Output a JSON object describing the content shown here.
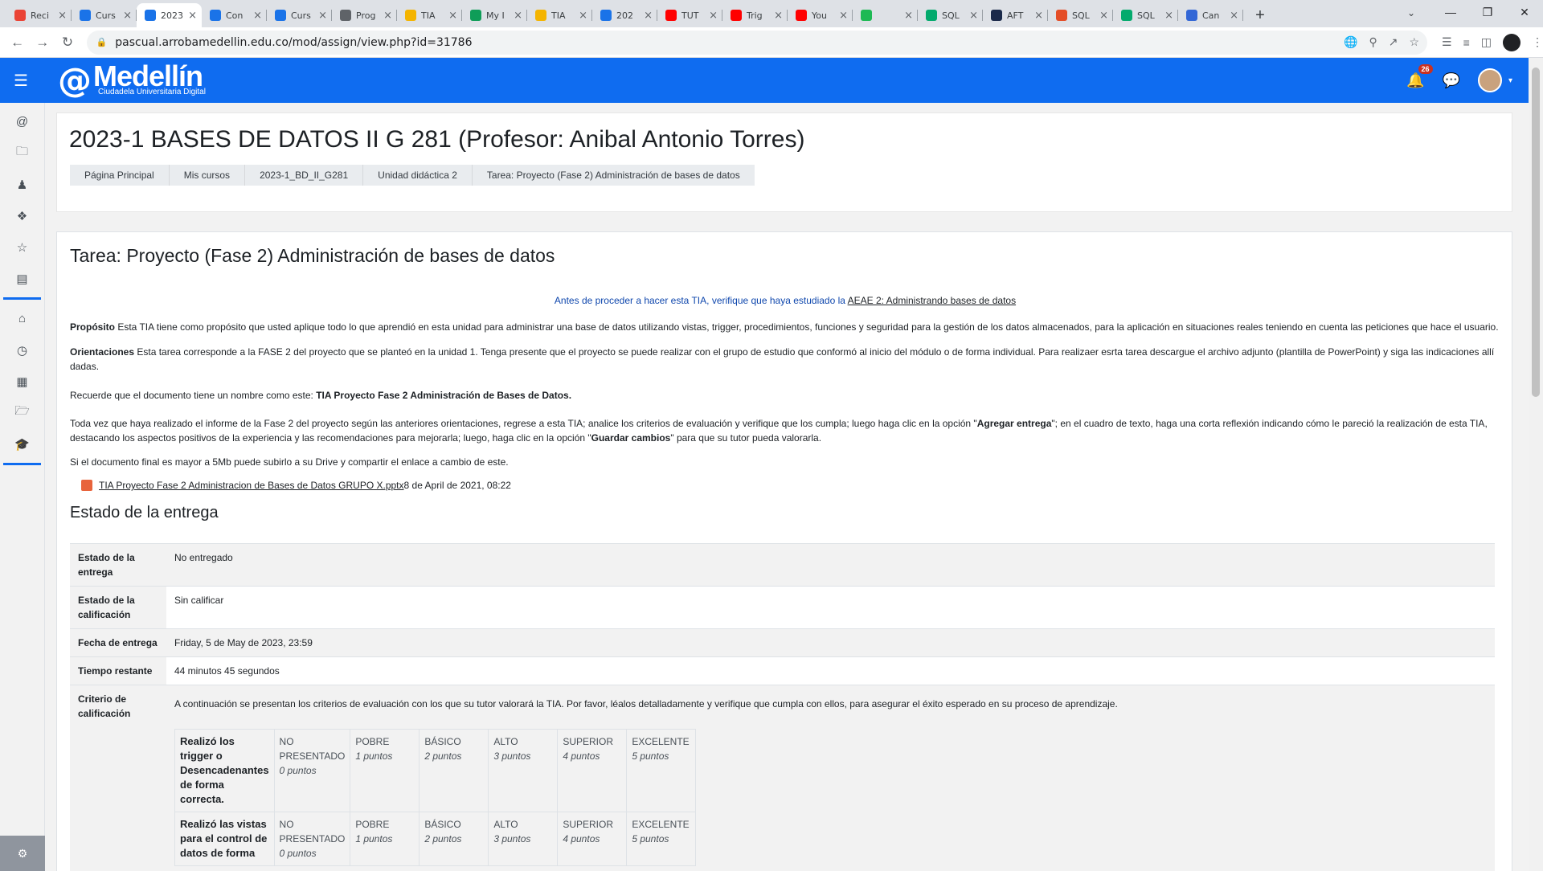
{
  "browser": {
    "tabs": [
      {
        "title": "Reci",
        "icon": "gmail-icon",
        "color": "#ea4335",
        "active": false
      },
      {
        "title": "Curs",
        "icon": "moodle-at-icon",
        "color": "#1a73e8",
        "active": false
      },
      {
        "title": "2023",
        "icon": "moodle-at-icon",
        "color": "#1a73e8",
        "active": true
      },
      {
        "title": "Con",
        "icon": "moodle-at-icon",
        "color": "#1a73e8",
        "active": false
      },
      {
        "title": "Curs",
        "icon": "moodle-at-icon",
        "color": "#1a73e8",
        "active": false
      },
      {
        "title": "Prog",
        "icon": "globe-icon",
        "color": "#5f6368",
        "active": false
      },
      {
        "title": "TIA",
        "icon": "slides-icon",
        "color": "#f4b400",
        "active": false
      },
      {
        "title": "My I",
        "icon": "drive-icon",
        "color": "#0f9d58",
        "active": false
      },
      {
        "title": "TIA",
        "icon": "slides-icon",
        "color": "#f4b400",
        "active": false
      },
      {
        "title": "202",
        "icon": "moodle-at-icon",
        "color": "#1a73e8",
        "active": false
      },
      {
        "title": "TUT",
        "icon": "youtube-icon",
        "color": "#ff0000",
        "active": false
      },
      {
        "title": "Trig",
        "icon": "youtube-icon",
        "color": "#ff0000",
        "active": false
      },
      {
        "title": "You",
        "icon": "youtube-icon",
        "color": "#ff0000",
        "active": false
      },
      {
        "title": "",
        "icon": "spotify-icon",
        "color": "#1db954",
        "active": false
      },
      {
        "title": "SQL",
        "icon": "w3schools-icon",
        "color": "#04aa6d",
        "active": false
      },
      {
        "title": "AFT",
        "icon": "generic-site-icon",
        "color": "#1b2a4a",
        "active": false
      },
      {
        "title": "SQL",
        "icon": "sql-site-icon",
        "color": "#e44d26",
        "active": false
      },
      {
        "title": "SQL",
        "icon": "w3schools-icon",
        "color": "#04aa6d",
        "active": false
      },
      {
        "title": "Can",
        "icon": "generic-site-icon",
        "color": "#3367d6",
        "active": false
      }
    ],
    "url": "pascual.arrobamedellin.edu.co/mod/assign/view.php?id=31786"
  },
  "navbar": {
    "brand_at": "@",
    "brand_name": "Medellín",
    "brand_sub": "Ciudadela Universitaria Digital",
    "notification_count": "26",
    "color": "#0f6cf0"
  },
  "header": {
    "course_title": "2023-1 BASES DE DATOS II G 281 (Profesor: Anibal Antonio Torres)",
    "breadcrumb": [
      "Página Principal",
      "Mis cursos",
      "2023-1_BD_II_G281",
      "Unidad didáctica 2",
      "Tarea: Proyecto (Fase 2) Administración de bases de datos"
    ]
  },
  "assignment": {
    "title": "Tarea: Proyecto (Fase 2) Administración de bases de datos",
    "intro_text": "Antes de proceder a hacer esta TIA, verifique que haya estudiado la ",
    "intro_link": "AEAE 2: Administrando bases de datos",
    "proposito_label": "Propósito",
    "proposito_text": " Esta TIA tiene como propósito que usted aplique todo lo que aprendió en esta unidad para administrar una base de datos utilizando vistas, trigger, procedimientos, funciones y seguridad para la gestión de los datos almacenados, para la aplicación en situaciones reales teniendo en cuenta las peticiones que hace el usuario.",
    "orientaciones_label": "Orientaciones",
    "orientaciones_text": " Esta tarea corresponde a la FASE 2 del proyecto que se planteó en la unidad 1. Tenga presente que el proyecto se puede realizar con el grupo de estudio que conformó al inicio del módulo o de forma individual. Para realizaer esrta tarea descargue el archivo adjunto (plantilla de PowerPoint) y siga las indicaciones allí dadas.",
    "recuerde_text": "Recuerde que el documento tiene un nombre como este: ",
    "recuerde_bold": "TIA Proyecto Fase 2 Administración de Bases de Datos.",
    "instr_1": "Toda vez que haya realizado el informe de la Fase 2 del proyecto según las anteriores orientaciones, regrese a esta TIA; analice los criterios de evaluación y verifique que los cumpla; luego haga clic en la opción \"",
    "instr_bold_1": "Agregar entrega",
    "instr_2": "\"; en el cuadro de texto, haga una corta reflexión indicando cómo le pareció la realización de esta TIA, destacando los aspectos positivos de la experiencia y las recomendaciones para mejorarla; luego, haga clic en la opción \"",
    "instr_bold_2": "Guardar cambios",
    "instr_3": "\" para que su tutor pueda valorarla.",
    "drive_text": "Si el documento final es mayor a 5Mb puede subirlo a su Drive y compartir el enlace a cambio de este.",
    "attachment_name": "TIA Proyecto Fase 2 Administracion de Bases de Datos GRUPO X.pptx",
    "attachment_date": "8 de April de 2021, 08:22"
  },
  "submission": {
    "section_title": "Estado de la entrega",
    "rows": [
      {
        "label": "Estado de la entrega",
        "value": "No entregado"
      },
      {
        "label": "Estado de la calificación",
        "value": "Sin calificar"
      },
      {
        "label": "Fecha de entrega",
        "value": "Friday, 5 de May de 2023, 23:59"
      },
      {
        "label": "Tiempo restante",
        "value": "44 minutos 45 segundos"
      },
      {
        "label": "Criterio de calificación",
        "value": "A continuación se presentan los criterios de evaluación con los que su tutor valorará la TIA. Por favor, léalos detalladamente y verifique que cumpla con ellos, para asegurar el éxito esperado en su proceso de aprendizaje."
      }
    ]
  },
  "rubric": {
    "criteria": [
      {
        "name": "Realizó los trigger o Desencadenantes de forma correcta.",
        "levels": [
          {
            "label": "NO PRESENTADO",
            "points": "0 puntos"
          },
          {
            "label": "POBRE",
            "points": "1 puntos"
          },
          {
            "label": "BÁSICO",
            "points": "2 puntos"
          },
          {
            "label": "ALTO",
            "points": "3 puntos"
          },
          {
            "label": "SUPERIOR",
            "points": "4 puntos"
          },
          {
            "label": "EXCELENTE",
            "points": "5 puntos"
          }
        ]
      },
      {
        "name": "Realizó las vistas para el control de datos de forma",
        "levels": [
          {
            "label": "NO PRESENTADO",
            "points": "0 puntos"
          },
          {
            "label": "POBRE",
            "points": "1 puntos"
          },
          {
            "label": "BÁSICO",
            "points": "2 puntos"
          },
          {
            "label": "ALTO",
            "points": "3 puntos"
          },
          {
            "label": "SUPERIOR",
            "points": "4 puntos"
          },
          {
            "label": "EXCELENTE",
            "points": "5 puntos"
          }
        ]
      }
    ]
  }
}
